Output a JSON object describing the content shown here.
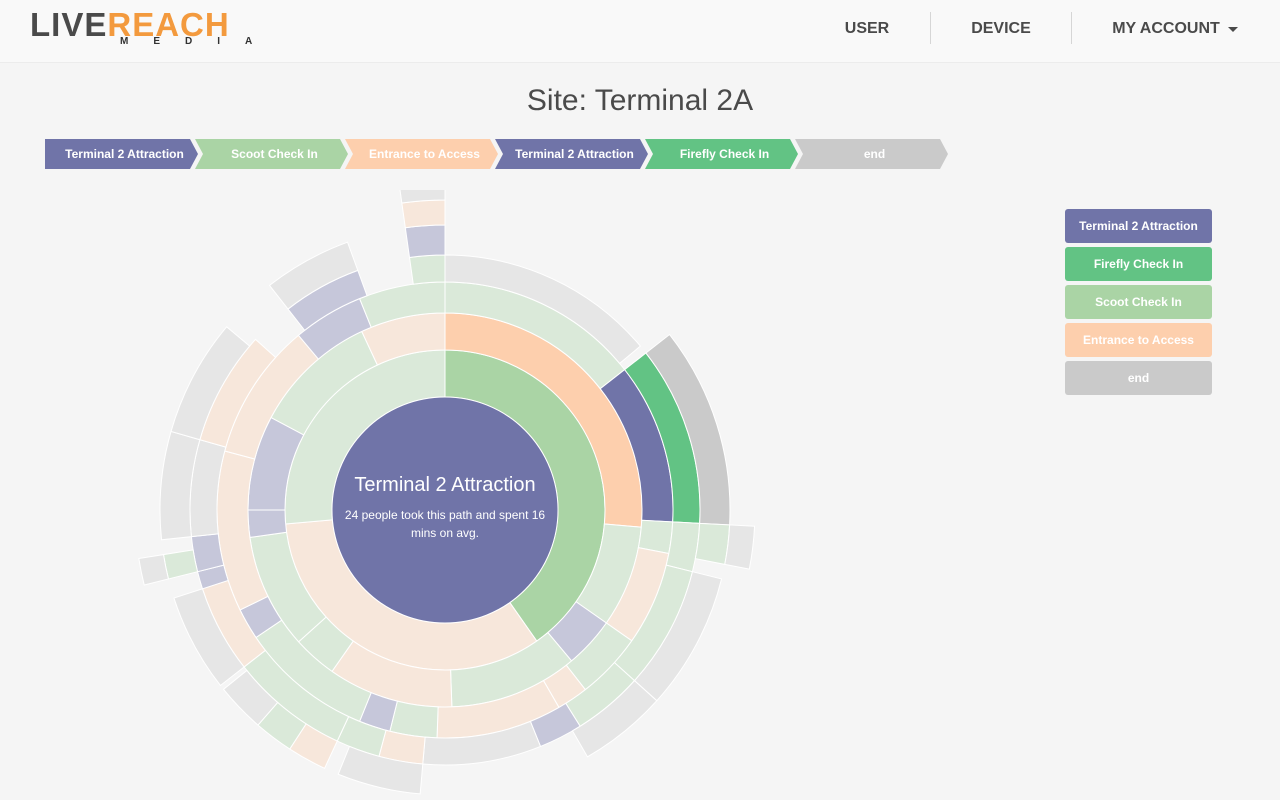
{
  "header": {
    "logo_main_a": "LIVE",
    "logo_main_b": "REACH",
    "logo_sub": "MEDIA",
    "nav": [
      {
        "label": "USER"
      },
      {
        "label": "DEVICE"
      },
      {
        "label": "MY ACCOUNT"
      }
    ]
  },
  "page": {
    "title": "Site: Terminal 2A"
  },
  "breadcrumb": [
    {
      "label": "Terminal 2 Attraction",
      "color": "#7074a8"
    },
    {
      "label": "Scoot Check In",
      "color": "#aad4a5"
    },
    {
      "label": "Entrance to Access",
      "color": "#fdcfad"
    },
    {
      "label": "Terminal 2 Attraction",
      "color": "#7074a8"
    },
    {
      "label": "Firefly Check In",
      "color": "#62c384"
    },
    {
      "label": "end",
      "color": "#cacaca"
    }
  ],
  "legend": [
    {
      "label": "Terminal 2 Attraction",
      "color": "#7074a8"
    },
    {
      "label": "Firefly Check In",
      "color": "#62c384"
    },
    {
      "label": "Scoot Check In",
      "color": "#aad4a5"
    },
    {
      "label": "Entrance to Access",
      "color": "#fdcfad"
    },
    {
      "label": "end",
      "color": "#cacaca"
    }
  ],
  "center": {
    "title": "Terminal 2 Attraction",
    "desc": "24 people took this path and spent 16 mins on avg."
  },
  "chart_data": {
    "type": "sunburst",
    "root": "Terminal 2 Attraction",
    "highlighted_path": [
      "Scoot Check In",
      "Entrance to Access",
      "Terminal 2 Attraction",
      "Firefly Check In",
      "end"
    ],
    "legend_position": "right",
    "segments": [
      {
        "depth": 1,
        "category": "Scoot Check In",
        "start": 0,
        "end": 145,
        "highlighted": true
      },
      {
        "depth": 1,
        "category": "Entrance to Access",
        "start": 145,
        "end": 265
      },
      {
        "depth": 1,
        "category": "Scoot Check In",
        "start": 265,
        "end": 360
      },
      {
        "depth": 2,
        "category": "Entrance to Access",
        "start": 0,
        "end": 95,
        "highlighted": true
      },
      {
        "depth": 2,
        "category": "Scoot Check In",
        "start": 95,
        "end": 125
      },
      {
        "depth": 2,
        "category": "Terminal 2 Attraction",
        "start": 125,
        "end": 140
      },
      {
        "depth": 2,
        "category": "Scoot Check In",
        "start": 140,
        "end": 178
      },
      {
        "depth": 2,
        "category": "Entrance to Access",
        "start": 178,
        "end": 215
      },
      {
        "depth": 2,
        "category": "Scoot Check In",
        "start": 215,
        "end": 228
      },
      {
        "depth": 2,
        "category": "Scoot Check In",
        "start": 228,
        "end": 262
      },
      {
        "depth": 2,
        "category": "Terminal 2 Attraction",
        "start": 262,
        "end": 270
      },
      {
        "depth": 2,
        "category": "Terminal 2 Attraction",
        "start": 270,
        "end": 298
      },
      {
        "depth": 2,
        "category": "Scoot Check In",
        "start": 298,
        "end": 335
      },
      {
        "depth": 2,
        "category": "Entrance to Access",
        "start": 335,
        "end": 360
      },
      {
        "depth": 3,
        "category": "Scoot Check In",
        "start": 0,
        "end": 52
      },
      {
        "depth": 3,
        "category": "Terminal 2 Attraction",
        "start": 52,
        "end": 93,
        "highlighted": true
      },
      {
        "depth": 3,
        "category": "Scoot Check In",
        "start": 93,
        "end": 101
      },
      {
        "depth": 3,
        "category": "Entrance to Access",
        "start": 101,
        "end": 125
      },
      {
        "depth": 3,
        "category": "Scoot Check In",
        "start": 125,
        "end": 142
      },
      {
        "depth": 3,
        "category": "Entrance to Access",
        "start": 142,
        "end": 150
      },
      {
        "depth": 3,
        "category": "Entrance to Access",
        "start": 150,
        "end": 182
      },
      {
        "depth": 3,
        "category": "Scoot Check In",
        "start": 182,
        "end": 194
      },
      {
        "depth": 3,
        "category": "Terminal 2 Attraction",
        "start": 194,
        "end": 202
      },
      {
        "depth": 3,
        "category": "Scoot Check In",
        "start": 202,
        "end": 236
      },
      {
        "depth": 3,
        "category": "Terminal 2 Attraction",
        "start": 236,
        "end": 244
      },
      {
        "depth": 3,
        "category": "Entrance to Access",
        "start": 244,
        "end": 285
      },
      {
        "depth": 3,
        "category": "Entrance to Access",
        "start": 285,
        "end": 320
      },
      {
        "depth": 3,
        "category": "Terminal 2 Attraction",
        "start": 320,
        "end": 338
      },
      {
        "depth": 3,
        "category": "Scoot Check In",
        "start": 338,
        "end": 360
      },
      {
        "depth": 4,
        "category": "end",
        "start": 0,
        "end": 50
      },
      {
        "depth": 4,
        "category": "Firefly Check In",
        "start": 52,
        "end": 93,
        "highlighted": true
      },
      {
        "depth": 4,
        "category": "Scoot Check In",
        "start": 93,
        "end": 104
      },
      {
        "depth": 4,
        "category": "Scoot Check In",
        "start": 104,
        "end": 132
      },
      {
        "depth": 4,
        "category": "Scoot Check In",
        "start": 132,
        "end": 148
      },
      {
        "depth": 4,
        "category": "Terminal 2 Attraction",
        "start": 148,
        "end": 158
      },
      {
        "depth": 4,
        "category": "end",
        "start": 158,
        "end": 185
      },
      {
        "depth": 4,
        "category": "Entrance to Access",
        "start": 185,
        "end": 195
      },
      {
        "depth": 4,
        "category": "Scoot Check In",
        "start": 195,
        "end": 205
      },
      {
        "depth": 4,
        "category": "Scoot Check In",
        "start": 205,
        "end": 232
      },
      {
        "depth": 4,
        "category": "Entrance to Access",
        "start": 232,
        "end": 252
      },
      {
        "depth": 4,
        "category": "Terminal 2 Attraction",
        "start": 252,
        "end": 256
      },
      {
        "depth": 4,
        "category": "Terminal 2 Attraction",
        "start": 256,
        "end": 264
      },
      {
        "depth": 4,
        "category": "end",
        "start": 264,
        "end": 286
      },
      {
        "depth": 4,
        "category": "Entrance to Access",
        "start": 286,
        "end": 312
      },
      {
        "depth": 4,
        "category": "Terminal 2 Attraction",
        "start": 322,
        "end": 340
      },
      {
        "depth": 4,
        "category": "Scoot Check In",
        "start": 352,
        "end": 360
      },
      {
        "depth": 5,
        "category": "end",
        "start": 52,
        "end": 93,
        "highlighted": true
      },
      {
        "depth": 5,
        "category": "Scoot Check In",
        "start": 93,
        "end": 101
      },
      {
        "depth": 5,
        "category": "end",
        "start": 104,
        "end": 132
      },
      {
        "depth": 5,
        "category": "end",
        "start": 132,
        "end": 150
      },
      {
        "depth": 5,
        "category": "end",
        "start": 185,
        "end": 202
      },
      {
        "depth": 5,
        "category": "Entrance to Access",
        "start": 205,
        "end": 213
      },
      {
        "depth": 5,
        "category": "Scoot Check In",
        "start": 213,
        "end": 221
      },
      {
        "depth": 5,
        "category": "end",
        "start": 221,
        "end": 231
      },
      {
        "depth": 5,
        "category": "end",
        "start": 232,
        "end": 252
      },
      {
        "depth": 5,
        "category": "Scoot Check In",
        "start": 256,
        "end": 261
      },
      {
        "depth": 5,
        "category": "end",
        "start": 264,
        "end": 286
      },
      {
        "depth": 5,
        "category": "end",
        "start": 286,
        "end": 310
      },
      {
        "depth": 5,
        "category": "end",
        "start": 322,
        "end": 340
      },
      {
        "depth": 5,
        "category": "Terminal 2 Attraction",
        "start": 352,
        "end": 360
      },
      {
        "depth": 6,
        "category": "end",
        "start": 93,
        "end": 101
      },
      {
        "depth": 6,
        "category": "end",
        "start": 256,
        "end": 261
      },
      {
        "depth": 6,
        "category": "Entrance to Access",
        "start": 352,
        "end": 360
      },
      {
        "depth": 7,
        "category": "end",
        "start": 352,
        "end": 360
      }
    ]
  }
}
